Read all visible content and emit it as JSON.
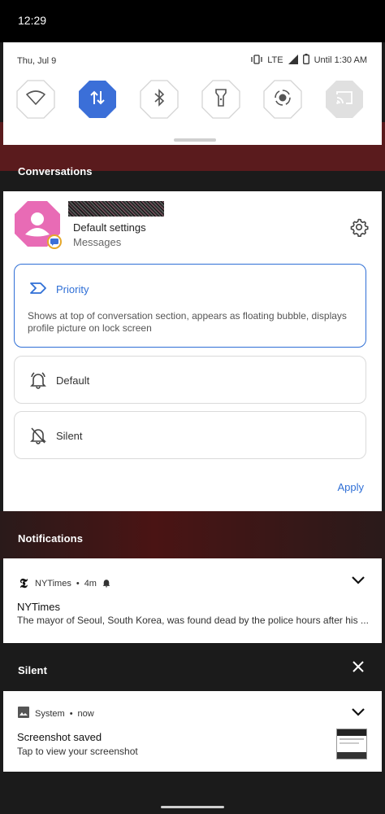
{
  "status_bar": {
    "time": "12:29"
  },
  "quick_settings": {
    "date": "Thu, Jul 9",
    "network": "LTE",
    "battery_text": "Until 1:30 AM",
    "tiles": [
      {
        "icon": "wifi-icon",
        "active": false
      },
      {
        "icon": "mobile-data-icon",
        "active": true
      },
      {
        "icon": "bluetooth-icon",
        "active": false
      },
      {
        "icon": "flashlight-icon",
        "active": false
      },
      {
        "icon": "screen-record-icon",
        "active": false
      },
      {
        "icon": "cast-icon",
        "active": false
      }
    ]
  },
  "conversations": {
    "header": "Conversations",
    "card": {
      "title": "Default settings",
      "subtitle": "Messages",
      "options": [
        {
          "label": "Priority",
          "icon": "priority-icon",
          "selected": true,
          "description": "Shows at top of conversation section, appears as floating bubble, displays profile picture on lock screen"
        },
        {
          "label": "Default",
          "icon": "bell-icon",
          "selected": false
        },
        {
          "label": "Silent",
          "icon": "bell-off-icon",
          "selected": false
        }
      ],
      "apply_label": "Apply"
    }
  },
  "notifications": {
    "header": "Notifications",
    "nytimes": {
      "app_name": "NYTimes",
      "separator": "•",
      "time": "4m",
      "title": "NYTimes",
      "text": "The mayor of Seoul, South Korea, was found dead by the police hours after his ..."
    }
  },
  "silent": {
    "header": "Silent",
    "screenshot": {
      "app_name": "System",
      "separator": "•",
      "time": "now",
      "title": "Screenshot saved",
      "text": "Tap to view your screenshot"
    }
  },
  "colors": {
    "accent": "#2f6fd6",
    "tile_active": "#3b6fd8",
    "avatar": "#e86bb5",
    "badge_ring": "#e5a72a"
  }
}
